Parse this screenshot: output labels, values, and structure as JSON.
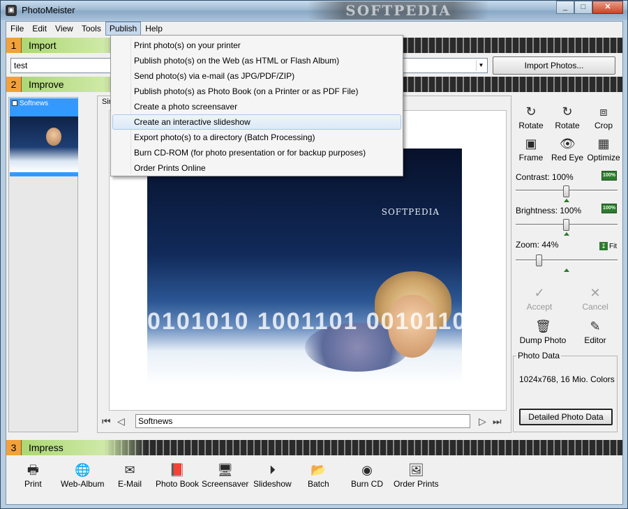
{
  "window": {
    "title": "PhotoMeister",
    "watermark": "SOFTPEDIA",
    "controls": {
      "minimize": "_",
      "maximize": "□",
      "close": "✕"
    }
  },
  "menubar": {
    "items": [
      "File",
      "Edit",
      "View",
      "Tools",
      "Publish",
      "Help"
    ],
    "active": "Publish"
  },
  "publish_menu": {
    "items": [
      "Print photo(s) on your printer",
      "Publish photo(s) on the Web (as HTML or Flash Album)",
      "Send photo(s) via e-mail (as JPG/PDF/ZIP)",
      "Publish photo(s) as Photo Book (on a Printer or as PDF File)",
      "Create a photo screensaver",
      "Create an interactive slideshow",
      "Export photo(s) to a directory (Batch Processing)",
      "Burn CD-ROM (for photo presentation or for backup purposes)",
      "Order Prints Online"
    ],
    "highlighted": "Create an interactive slideshow"
  },
  "sections": {
    "import": {
      "number": "1",
      "label": "Import"
    },
    "improve": {
      "number": "2",
      "label": "Improve"
    },
    "impress": {
      "number": "3",
      "label": "Impress"
    }
  },
  "import": {
    "path_value": "test",
    "button_label": "Import Photos..."
  },
  "thumbnails": [
    {
      "title": "Softnews",
      "selected": true
    }
  ],
  "preview": {
    "tab_label": "Sin",
    "photo_logo": "SOFTPEDIA",
    "photo_bits": "0101010 1001101 0010110",
    "caption": "Softnews"
  },
  "tools": {
    "rotate_left": "Rotate",
    "rotate_right": "Rotate",
    "crop": "Crop",
    "frame": "Frame",
    "red_eye": "Red Eye",
    "optimize": "Optimize",
    "accept": "Accept",
    "cancel": "Cancel",
    "dump_photo": "Dump Photo",
    "editor": "Editor"
  },
  "adjustments": {
    "contrast": {
      "label": "Contrast: 100%",
      "value_percent": 100
    },
    "brightness": {
      "label": "Brightness: 100%",
      "value_percent": 100
    },
    "zoom": {
      "label": "Zoom: 44%",
      "value_percent": 44
    },
    "fit_label": "Fit",
    "reset_badge": "100%"
  },
  "photo_data": {
    "title": "Photo Data",
    "info": "1024x768, 16 Mio. Colors",
    "details_button": "Detailed Photo Data"
  },
  "impress_tools": [
    "Print",
    "Web-Album",
    "E-Mail",
    "Photo Book",
    "Screensaver",
    "Slideshow",
    "Batch",
    "Burn CD",
    "Order Prints"
  ],
  "icons": {
    "rotate": "↻",
    "crop": "⧈",
    "frame": "▣",
    "red_eye": "👁",
    "optimize": "▦",
    "accept": "✓",
    "cancel": "✕",
    "dump": "🗑",
    "editor": "✎",
    "print": "🖶",
    "web": "🌐",
    "mail": "✉",
    "book": "📕",
    "screen": "🖥",
    "slideshow": "⏵",
    "batch": "📂",
    "burn": "◉",
    "order": "🖼",
    "first": "⏮",
    "prev": "◁",
    "next": "▷",
    "last": "⏭"
  },
  "colors": {
    "section_green": "#a6d46a",
    "section_orange": "#f2a13a",
    "selection_blue": "#3399ff",
    "highlight_border": "#a8c8ec"
  }
}
